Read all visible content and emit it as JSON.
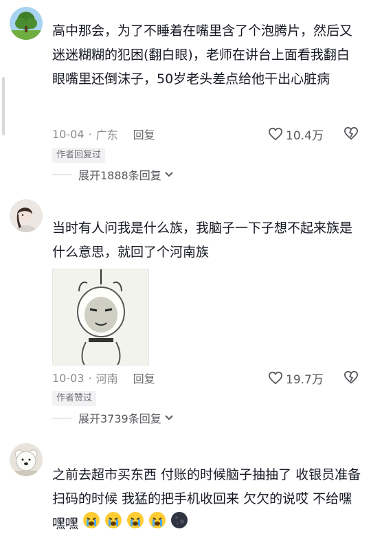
{
  "comments": [
    {
      "text": "高中那会，为了不睡着在嘴里含了个泡腾片，然后又迷迷糊糊的犯困(翻白眼)，老师在讲台上面看我翻白眼嘴里还倒沫子，50岁老头差点给他干出心脏病",
      "date": "10-04",
      "location": "广东",
      "reply_label": "回复",
      "likes": "10.4万",
      "badge": "作者回复过",
      "expand_label": "展开1888条回复",
      "avatar_icon": "tree-avatar-icon"
    },
    {
      "text": "当时有人问我是什么族，我脑子一下子想不起来族是什么意思，就回了个河南族",
      "date": "10-03",
      "location": "河南",
      "reply_label": "回复",
      "likes": "19.7万",
      "badge": "作者赞过",
      "expand_label": "展开3739条回复",
      "avatar_icon": "girl-avatar-icon",
      "sticker_icon": "meme-face-sticker-icon"
    },
    {
      "text": "之前去超市买东西 付账的时候脑子抽抽了 收银员准备扫码的时候 我猛的把手机收回来 欠欠的说哎 不给嘿嘿嘿",
      "avatar_icon": "bear-avatar-icon",
      "emoji_icons": [
        "loudly-crying-face-icon",
        "loudly-crying-face-icon",
        "loudly-crying-face-icon",
        "loudly-crying-face-icon",
        "dark-moon-face-icon"
      ]
    }
  ],
  "icons": {
    "like": "heart-outline-icon",
    "dislike": "broken-heart-icon",
    "chevron": "chevron-down-icon"
  },
  "colors": {
    "text": "#161823",
    "meta": "#8a8a8f",
    "badge_bg": "#f2f2f4"
  }
}
